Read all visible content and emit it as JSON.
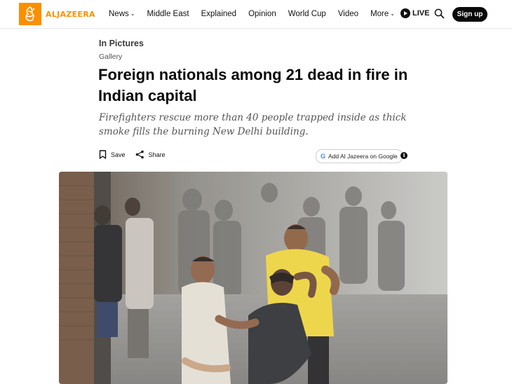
{
  "brand": {
    "logo_text": "ALJAZEERA",
    "accent_color": "#fa9000"
  },
  "nav": {
    "items": [
      {
        "label": "News",
        "has_menu": true
      },
      {
        "label": "Middle East",
        "has_menu": false
      },
      {
        "label": "Explained",
        "has_menu": false
      },
      {
        "label": "Opinion",
        "has_menu": false
      },
      {
        "label": "World Cup",
        "has_menu": false
      },
      {
        "label": "Video",
        "has_menu": false
      },
      {
        "label": "More",
        "has_menu": true
      }
    ],
    "live_label": "LIVE",
    "search_icon": "search-icon",
    "signup_label": "Sign up"
  },
  "article": {
    "section": "In Pictures",
    "subsection": "Gallery",
    "headline": "Foreign nationals among 21 dead in fire in Indian capital",
    "dek": "Firefighters rescue more than 40 people trapped inside as thick smoke fills the burning New Delhi building.",
    "save_label": "Save",
    "share_label": "Share",
    "google_label": "Add Al Jazeera on Google",
    "info_icon": "info-icon"
  }
}
